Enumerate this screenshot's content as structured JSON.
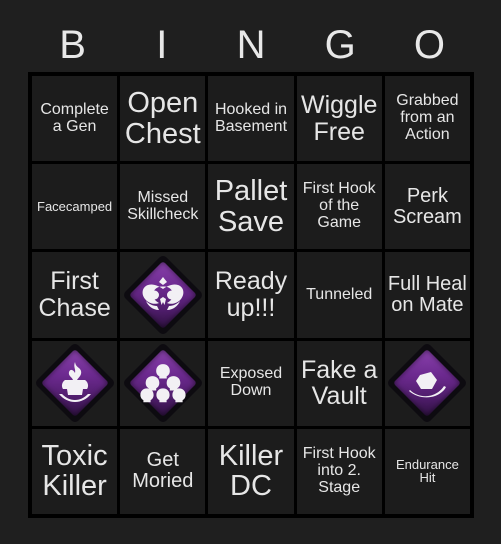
{
  "board": {
    "title": "BINGO",
    "header_letters": [
      "B",
      "I",
      "N",
      "G",
      "O"
    ],
    "columns": 5,
    "rows": 5,
    "colors": {
      "page_background": "#1f1f1f",
      "grid_line": "#000000",
      "cell_background": "#1c1c1c",
      "text": "#e6e6e6",
      "header_text": "#e8e8e8",
      "perk_purple": "#6d2a90",
      "perk_purple_light": "#8a42ad",
      "perk_frame": "#0d0b10",
      "perk_glyph": "#f2f0f4"
    }
  },
  "cells": [
    {
      "id": "r1c1",
      "row": 1,
      "col": 1,
      "type": "text",
      "text": "Complete a Gen",
      "size": "sm"
    },
    {
      "id": "r1c2",
      "row": 1,
      "col": 2,
      "type": "text",
      "text": "Open Chest",
      "size": "xl"
    },
    {
      "id": "r1c3",
      "row": 1,
      "col": 3,
      "type": "text",
      "text": "Hooked in Basement",
      "size": "sm"
    },
    {
      "id": "r1c4",
      "row": 1,
      "col": 4,
      "type": "text",
      "text": "Wiggle Free",
      "size": "lg"
    },
    {
      "id": "r1c5",
      "row": 1,
      "col": 5,
      "type": "text",
      "text": "Grabbed from an Action",
      "size": "sm"
    },
    {
      "id": "r2c1",
      "row": 2,
      "col": 1,
      "type": "text",
      "text": "Facecamped",
      "size": "xs"
    },
    {
      "id": "r2c2",
      "row": 2,
      "col": 2,
      "type": "text",
      "text": "Missed Skillcheck",
      "size": "sm"
    },
    {
      "id": "r2c3",
      "row": 2,
      "col": 3,
      "type": "text",
      "text": "Pallet Save",
      "size": "xl"
    },
    {
      "id": "r2c4",
      "row": 2,
      "col": 4,
      "type": "text",
      "text": "First Hook of the Game",
      "size": "sm"
    },
    {
      "id": "r2c5",
      "row": 2,
      "col": 5,
      "type": "text",
      "text": "Perk Scream",
      "size": "md"
    },
    {
      "id": "r3c1",
      "row": 3,
      "col": 1,
      "type": "text",
      "text": "First Chase",
      "size": "lg"
    },
    {
      "id": "r3c2",
      "row": 3,
      "col": 2,
      "type": "icon",
      "icon": "perk-face-icon",
      "text": ""
    },
    {
      "id": "r3c3",
      "row": 3,
      "col": 3,
      "type": "text",
      "text": "Ready up!!!",
      "size": "lg"
    },
    {
      "id": "r3c4",
      "row": 3,
      "col": 4,
      "type": "text",
      "text": "Tunneled",
      "size": "sm"
    },
    {
      "id": "r3c5",
      "row": 3,
      "col": 5,
      "type": "text",
      "text": "Full Heal on Mate",
      "size": "md"
    },
    {
      "id": "r4c1",
      "row": 4,
      "col": 1,
      "type": "icon",
      "icon": "perk-flame-idol-icon",
      "text": ""
    },
    {
      "id": "r4c2",
      "row": 4,
      "col": 2,
      "type": "icon",
      "icon": "perk-skull-pile-icon",
      "text": ""
    },
    {
      "id": "r4c3",
      "row": 4,
      "col": 3,
      "type": "text",
      "text": "Exposed Down",
      "size": "sm"
    },
    {
      "id": "r4c4",
      "row": 4,
      "col": 4,
      "type": "text",
      "text": "Fake a Vault",
      "size": "lg"
    },
    {
      "id": "r4c5",
      "row": 4,
      "col": 5,
      "type": "icon",
      "icon": "perk-shattered-hook-icon",
      "text": ""
    },
    {
      "id": "r5c1",
      "row": 5,
      "col": 1,
      "type": "text",
      "text": "Toxic Killer",
      "size": "xl"
    },
    {
      "id": "r5c2",
      "row": 5,
      "col": 2,
      "type": "text",
      "text": "Get Moried",
      "size": "md"
    },
    {
      "id": "r5c3",
      "row": 5,
      "col": 3,
      "type": "text",
      "text": "Killer DC",
      "size": "xl"
    },
    {
      "id": "r5c4",
      "row": 5,
      "col": 4,
      "type": "text",
      "text": "First Hook into 2. Stage",
      "size": "sm"
    },
    {
      "id": "r5c5",
      "row": 5,
      "col": 5,
      "type": "text",
      "text": "Endurance Hit",
      "size": "xs"
    }
  ]
}
